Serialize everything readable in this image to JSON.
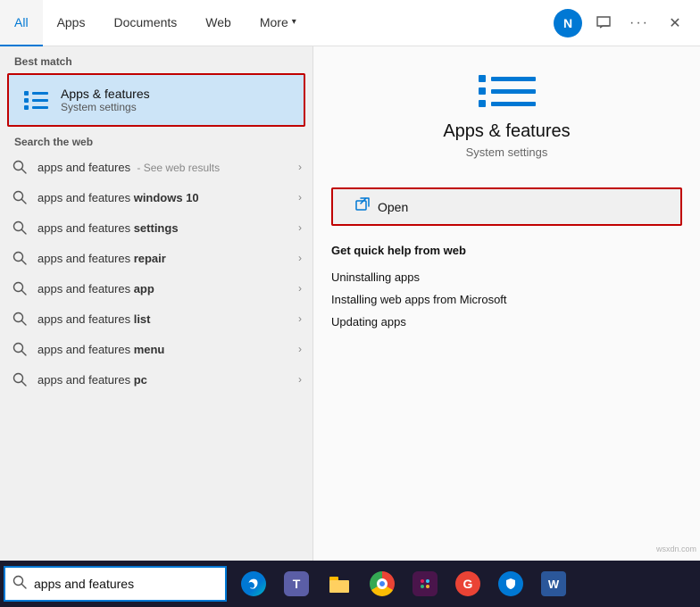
{
  "nav": {
    "tabs": [
      {
        "label": "All",
        "active": true
      },
      {
        "label": "Apps",
        "active": false
      },
      {
        "label": "Documents",
        "active": false
      },
      {
        "label": "Web",
        "active": false
      },
      {
        "label": "More",
        "active": false
      }
    ],
    "avatar_letter": "N",
    "more_icon": "▾"
  },
  "left_panel": {
    "best_match_label": "Best match",
    "best_match": {
      "title": "Apps & features",
      "subtitle": "System settings"
    },
    "search_web_label": "Search the web",
    "web_results": [
      {
        "prefix": "apps and features",
        "suffix": " - See web results",
        "bold_part": ""
      },
      {
        "prefix": "apps and features ",
        "bold_part": "windows 10",
        "suffix": ""
      },
      {
        "prefix": "apps and features ",
        "bold_part": "settings",
        "suffix": ""
      },
      {
        "prefix": "apps and features ",
        "bold_part": "repair",
        "suffix": ""
      },
      {
        "prefix": "apps and features ",
        "bold_part": "app",
        "suffix": ""
      },
      {
        "prefix": "apps and features ",
        "bold_part": "list",
        "suffix": ""
      },
      {
        "prefix": "apps and features ",
        "bold_part": "menu",
        "suffix": ""
      },
      {
        "prefix": "apps and features ",
        "bold_part": "pc",
        "suffix": ""
      }
    ]
  },
  "right_panel": {
    "title": "Apps & features",
    "subtitle": "System settings",
    "open_button": "Open",
    "quick_help_title": "Get quick help from web",
    "quick_help_links": [
      "Uninstalling apps",
      "Installing web apps from Microsoft",
      "Updating apps"
    ]
  },
  "taskbar": {
    "search_value": "apps and features",
    "search_placeholder": "apps and features"
  }
}
